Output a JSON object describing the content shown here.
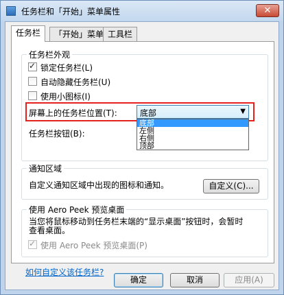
{
  "window": {
    "title": "任务栏和「开始」菜单属性",
    "close_label": "✕"
  },
  "tabs": [
    {
      "label": "任务栏",
      "active": true
    },
    {
      "label": "「开始」菜单",
      "active": false
    },
    {
      "label": "工具栏",
      "active": false
    }
  ],
  "appearance": {
    "title": "任务栏外观",
    "lock_taskbar": {
      "label": "锁定任务栏(L)",
      "checked": true
    },
    "auto_hide": {
      "label": "自动隐藏任务栏(U)",
      "checked": false
    },
    "small_icons": {
      "label": "使用小图标(I)",
      "checked": false
    },
    "location": {
      "label": "屏幕上的任务栏位置(T):",
      "value": "底部",
      "options": [
        "底部",
        "左侧",
        "右侧",
        "顶部"
      ]
    },
    "buttons_label": "任务栏按钮(B):"
  },
  "notification": {
    "title": "通知区域",
    "description": "自定义通知区域中出现的图标和通知。",
    "customize_label": "自定义(C)..."
  },
  "aero_peek": {
    "title": "使用 Aero Peek 预览桌面",
    "description_line1": "当您将鼠标移动到任务栏末端的“显示桌面”按钮时，会暂时",
    "description_line2": "查看桌面。",
    "checkbox": {
      "label": "使用 Aero Peek 预览桌面(P)",
      "checked": true
    }
  },
  "help_link": "如何自定义该任务栏?",
  "buttons": {
    "ok": "确定",
    "cancel": "取消",
    "apply": "应用(A)"
  }
}
